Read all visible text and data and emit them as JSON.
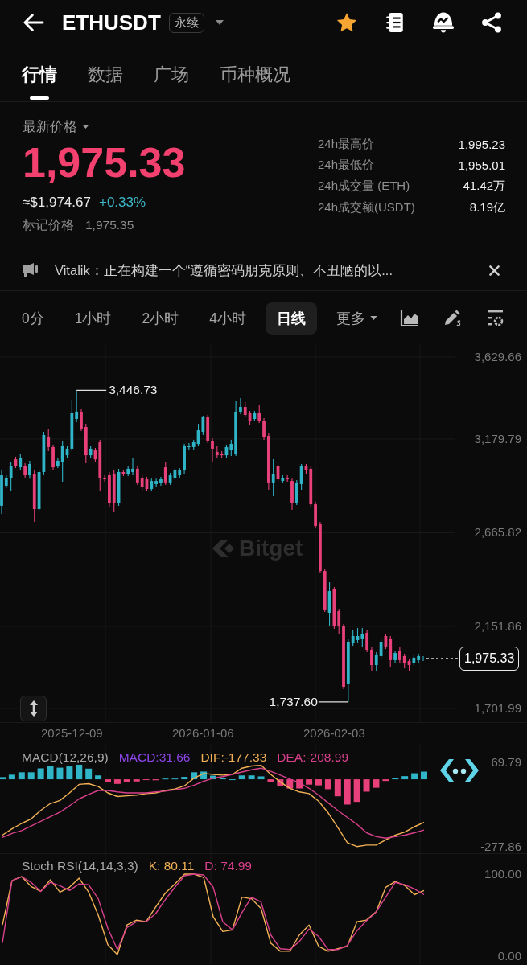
{
  "header": {
    "title": "ETHUSDT",
    "badge": "永续"
  },
  "tabs": [
    {
      "label": "行情",
      "selected": true
    },
    {
      "label": "数据",
      "selected": false
    },
    {
      "label": "广场",
      "selected": false
    },
    {
      "label": "币种概况",
      "selected": false
    }
  ],
  "price": {
    "label": "最新价格",
    "last": "1,975.33",
    "usd": "≈$1,974.67",
    "change": "+0.33%",
    "mark_label": "标记价格",
    "mark_value": "1,975.35"
  },
  "stats": [
    {
      "label": "24h最高价",
      "value": "1,995.23"
    },
    {
      "label": "24h最低价",
      "value": "1,955.01"
    },
    {
      "label": "24h成交量 (ETH)",
      "value": "41.42万"
    },
    {
      "label": "24h成交额(USDT)",
      "value": "8.19亿"
    }
  ],
  "announcement": {
    "text": "Vitalik：正在构建一个“遵循密码朋克原则、不丑陋的以..."
  },
  "intervals": [
    {
      "label": "0分",
      "selected": false
    },
    {
      "label": "1小时",
      "selected": false
    },
    {
      "label": "2小时",
      "selected": false
    },
    {
      "label": "4小时",
      "selected": false
    },
    {
      "label": "日线",
      "selected": true
    }
  ],
  "more_menu": {
    "label": "更多"
  },
  "chart": {
    "watermark": "Bitget",
    "chart_data": {
      "type": "candlestick",
      "grid": true,
      "categories": [
        null,
        null,
        null,
        null,
        null,
        null,
        null,
        null,
        null,
        null,
        null,
        null,
        null,
        null,
        null,
        "2025-12-09",
        null,
        null,
        null,
        null,
        null,
        null,
        null,
        null,
        null,
        null,
        null,
        null,
        null,
        null,
        null,
        null,
        null,
        null,
        null,
        null,
        null,
        null,
        null,
        null,
        null,
        null,
        null,
        "2026-01-06",
        null,
        null,
        null,
        null,
        null,
        null,
        null,
        null,
        null,
        null,
        null,
        null,
        null,
        null,
        null,
        null,
        null,
        null,
        null,
        null,
        null,
        null,
        null,
        null,
        null,
        null,
        null,
        "2026-02-03",
        null,
        null,
        null,
        null,
        null,
        null,
        null,
        null,
        null,
        null,
        null,
        null,
        null,
        null,
        null,
        null,
        null,
        null,
        null
      ],
      "ohlc": [
        [
          2814,
          3008,
          2769,
          2981
        ],
        [
          2924,
          2981,
          2911,
          2968
        ],
        [
          2968,
          3052,
          2893,
          3034
        ],
        [
          3069,
          3083,
          3021,
          3034
        ],
        [
          3025,
          3100,
          3008,
          3078
        ],
        [
          3034,
          3047,
          2968,
          2981
        ],
        [
          2981,
          3061,
          2963,
          3043
        ],
        [
          2990,
          3008,
          2725,
          2796
        ],
        [
          2796,
          3012,
          2783,
          2999
        ],
        [
          2999,
          3219,
          2981,
          3202
        ],
        [
          3189,
          3233,
          3113,
          3136
        ],
        [
          3136,
          3149,
          3012,
          3025
        ],
        [
          3034,
          3074,
          3021,
          3061
        ],
        [
          3052,
          3166,
          2946,
          3144
        ],
        [
          3091,
          3140,
          3078,
          3127
        ],
        [
          3127,
          3396,
          3113,
          3321
        ],
        [
          3290,
          3446.73,
          3272,
          3330
        ],
        [
          3330,
          3343,
          3224,
          3237
        ],
        [
          3246,
          3263,
          3047,
          3091
        ],
        [
          3091,
          3140,
          3078,
          3127
        ],
        [
          3118,
          3131,
          3056,
          3069
        ],
        [
          3162,
          3175,
          2893,
          2968
        ],
        [
          2968,
          2981,
          2946,
          2959
        ],
        [
          2981,
          2999,
          2805,
          2831
        ],
        [
          2990,
          3012,
          2778,
          2831
        ],
        [
          2831,
          3017,
          2814,
          2999
        ],
        [
          2999,
          3012,
          2977,
          2990
        ],
        [
          2990,
          3030,
          2977,
          3017
        ],
        [
          2999,
          3078,
          2981,
          3017
        ],
        [
          3017,
          3030,
          2928,
          2942
        ],
        [
          2968,
          2981,
          2902,
          2915
        ],
        [
          2959,
          2972,
          2893,
          2906
        ],
        [
          2906,
          2963,
          2893,
          2950
        ],
        [
          2933,
          2963,
          2919,
          2950
        ],
        [
          2937,
          2972,
          2924,
          2959
        ],
        [
          3025,
          3056,
          2928,
          2942
        ],
        [
          2942,
          2994,
          2928,
          2981
        ],
        [
          2968,
          3021,
          2955,
          3008
        ],
        [
          2981,
          3021,
          2968,
          3008
        ],
        [
          3008,
          3153,
          2990,
          3144
        ],
        [
          3136,
          3158,
          3122,
          3144
        ],
        [
          3136,
          3175,
          3122,
          3162
        ],
        [
          3153,
          3263,
          3140,
          3228
        ],
        [
          3219,
          3308,
          3202,
          3299
        ],
        [
          3299,
          3312,
          3158,
          3171
        ],
        [
          3171,
          3184,
          3056,
          3127
        ],
        [
          3109,
          3144,
          3078,
          3091
        ],
        [
          3100,
          3113,
          3078,
          3091
        ],
        [
          3091,
          3149,
          3078,
          3136
        ],
        [
          3118,
          3175,
          3087,
          3153
        ],
        [
          3100,
          3387,
          3087,
          3330
        ],
        [
          3330,
          3405,
          3316,
          3356
        ],
        [
          3356,
          3383,
          3299,
          3312
        ],
        [
          3321,
          3334,
          3255,
          3281
        ],
        [
          3290,
          3334,
          3277,
          3321
        ],
        [
          3321,
          3365,
          3268,
          3281
        ],
        [
          3281,
          3294,
          3175,
          3189
        ],
        [
          3197,
          3211,
          2902,
          2942
        ],
        [
          2942,
          3069,
          2867,
          2990
        ],
        [
          3034,
          3056,
          2946,
          2959
        ],
        [
          2950,
          2981,
          2937,
          2968
        ],
        [
          2968,
          2981,
          2946,
          2959
        ],
        [
          2950,
          2963,
          2792,
          2831
        ],
        [
          2831,
          2955,
          2818,
          2942
        ],
        [
          2933,
          3043,
          2902,
          3034
        ],
        [
          3034,
          3043,
          2990,
          3008
        ],
        [
          3017,
          3030,
          2809,
          2822
        ],
        [
          2822,
          2836,
          2690,
          2703
        ],
        [
          2712,
          2725,
          2443,
          2456
        ],
        [
          2456,
          2470,
          2231,
          2245
        ],
        [
          2227,
          2395,
          2152,
          2346
        ],
        [
          2355,
          2368,
          2139,
          2152
        ],
        [
          2236,
          2249,
          2108,
          2152
        ],
        [
          2152,
          2165,
          1808,
          1821
        ],
        [
          1839,
          2081,
          1737.6,
          2068
        ],
        [
          2059,
          2130,
          2046,
          2099
        ],
        [
          2077,
          2143,
          2064,
          2099
        ],
        [
          2086,
          2143,
          2042,
          2108
        ],
        [
          2117,
          2130,
          2011,
          2024
        ],
        [
          2024,
          2037,
          1905,
          1940
        ],
        [
          1940,
          2011,
          1905,
          1998
        ],
        [
          1989,
          2081,
          1975,
          2068
        ],
        [
          2099,
          2108,
          2028,
          2042
        ],
        [
          2086,
          2099,
          1931,
          1967
        ],
        [
          1967,
          2020,
          1953,
          2006
        ],
        [
          2015,
          2037,
          1953,
          1967
        ],
        [
          1989,
          2002,
          1923,
          1949
        ],
        [
          1962,
          1975,
          1909,
          1940
        ],
        [
          1949,
          1993,
          1936,
          1980
        ],
        [
          1967,
          2002,
          1953,
          1989
        ],
        [
          1971,
          1989,
          1962,
          1975.33
        ]
      ],
      "ylim": [
        1627.0,
        3695.8
      ],
      "yticks": [
        {
          "value": 3629.66,
          "label": "3,629.66"
        },
        {
          "value": 3179.79,
          "label": "3,179.79"
        },
        {
          "value": 2665.82,
          "label": "2,665.82"
        },
        {
          "value": 2151.86,
          "label": "2,151.86"
        },
        {
          "value": 1701.99,
          "label": "1,701.99"
        }
      ],
      "annotations": [
        "3,446.73",
        "1,737.60",
        "1,975.33"
      ]
    }
  },
  "macd": {
    "title": "MACD(12,26,9)",
    "macd": "MACD:31.66",
    "chart_data": {
      "type": "line",
      "grid": true,
      "series": [
        {
          "type": "bar",
          "color": "#2fb4c8",
          "values": [
            9,
            19,
            29,
            29,
            45,
            54,
            48,
            53,
            60,
            44,
            16,
            null,
            null,
            null,
            null,
            null,
            null,
            3,
            3,
            10,
            29,
            32,
            15,
            6,
            0,
            16,
            16,
            12,
            null,
            null,
            null,
            null,
            null,
            null,
            null,
            null,
            null,
            null,
            null,
            null,
            null,
            6,
            13,
            25,
            31.66
          ]
        },
        {
          "type": "bar",
          "color": "#e8407a",
          "values": [
            null,
            null,
            null,
            null,
            null,
            null,
            null,
            null,
            null,
            null,
            null,
            -10,
            -19,
            -12,
            -9,
            -3,
            -4,
            null,
            null,
            null,
            null,
            null,
            null,
            null,
            null,
            null,
            null,
            null,
            -13,
            -28,
            -38,
            -38,
            -22,
            -25,
            -41,
            -70,
            -104,
            -93,
            -51,
            -35,
            -7,
            null,
            null,
            null,
            null
          ]
        },
        {
          "name": "DIF:-177.33",
          "color": "#f2b155",
          "values": [
            -230,
            -204,
            -182,
            -163,
            -128,
            -100,
            -87,
            -56,
            -21,
            -18,
            -30,
            -56,
            -71,
            -68,
            -65,
            -59,
            -56,
            -46,
            -40,
            -27,
            5,
            24,
            20,
            17,
            20,
            46,
            55,
            58,
            20,
            -11,
            -37,
            -52,
            -59,
            -90,
            -138,
            -198,
            -261,
            -277,
            -271,
            -271,
            -249,
            -230,
            -217,
            -195,
            -177.33
          ]
        },
        {
          "name": "DEA:-208.99",
          "color": "#d9408c",
          "values": [
            -239,
            -223,
            -211,
            -192,
            -173,
            -154,
            -135,
            -109,
            -81,
            -62,
            -46,
            -46,
            -52,
            -56,
            -56,
            -56,
            -52,
            -49,
            -43,
            -37,
            -24,
            -8,
            5,
            11,
            20,
            30,
            39,
            46,
            33,
            17,
            1,
            -14,
            -37,
            -65,
            -97,
            -128,
            -157,
            -185,
            -220,
            -236,
            -242,
            -236,
            -230,
            -220,
            -208.99
          ]
        }
      ],
      "ylim": [
        -277.86,
        69.79
      ],
      "yticks": [
        {
          "value": 69.79,
          "label": "69.79"
        },
        {
          "value": -277.86,
          "label": "-277.86"
        }
      ]
    }
  },
  "stoch_rsi": {
    "title": "Stoch RSI(14,14,3,3)",
    "chart_data": {
      "type": "line",
      "grid": true,
      "series": [
        {
          "name": "K: 80.11",
          "color": "#f2b155",
          "values": [
            38,
            92,
            97,
            85,
            79,
            93,
            78,
            84,
            95,
            78,
            50,
            14,
            2,
            38,
            44,
            42,
            60,
            77,
            88,
            100,
            100,
            96,
            48,
            30,
            32,
            72,
            70,
            58,
            16,
            6,
            6,
            26,
            38,
            12,
            6,
            9,
            12,
            42,
            44,
            54,
            84,
            91,
            86,
            75,
            80.11
          ]
        },
        {
          "name": "D: 74.99",
          "color": "#d9408c",
          "values": [
            16,
            92,
            97,
            90,
            79,
            90,
            86,
            80,
            88,
            87,
            70,
            34,
            8,
            35,
            42,
            42,
            52,
            69,
            84,
            98,
            100,
            99,
            84,
            42,
            32,
            53,
            72,
            66,
            26,
            9,
            8,
            18,
            33,
            24,
            8,
            8,
            13,
            31,
            43,
            54,
            72,
            90,
            87,
            82,
            74.99
          ]
        }
      ],
      "ylim": [
        0,
        100
      ],
      "yticks": [
        {
          "value": 100,
          "label": "100.00"
        },
        {
          "value": 0,
          "label": "0.00"
        }
      ]
    }
  }
}
